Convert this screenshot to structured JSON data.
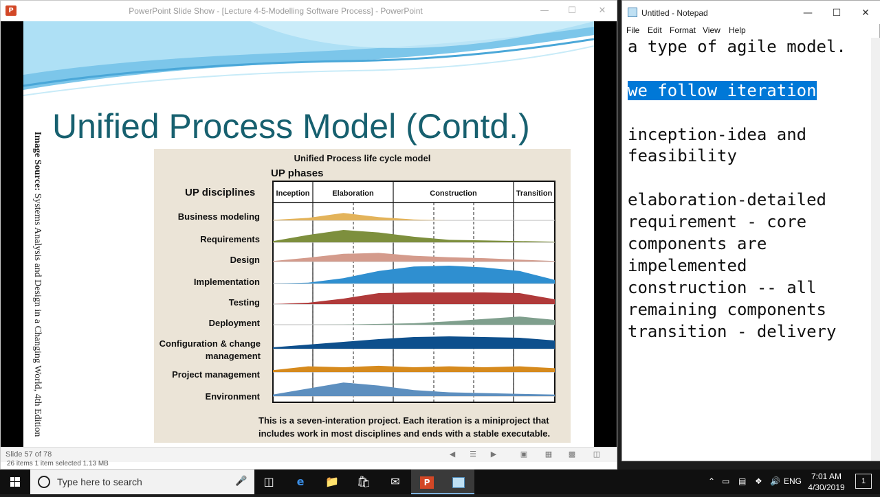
{
  "powerpoint": {
    "title": "PowerPoint Slide Show - [Lecture 4-5-Modelling Software Process] - PowerPoint",
    "logo_letter": "P",
    "status_slide": "Slide 57 of 78",
    "behind_status": "26 items     1 item selected  1.13 MB"
  },
  "slide": {
    "title": "Unified Process Model (Contd.)",
    "image_source_bold": "Image Source:",
    "image_source_text": " Systems Analysis and Design in a Changing World, 4th Edition",
    "figure": {
      "title": "Unified Process life cycle model",
      "phases_label": "UP phases",
      "disciplines_label": "UP disciplines",
      "phases": [
        "Inception",
        "Elaboration",
        "Construction",
        "Transition"
      ],
      "disciplines": [
        "Business modeling",
        "Requirements",
        "Design",
        "Implementation",
        "Testing",
        "Deployment",
        "Configuration & change management",
        "Project management",
        "Environment"
      ],
      "discipline_colors": [
        "#e3b35a",
        "#7d8f3d",
        "#d49b8c",
        "#2f8fd0",
        "#b03a3a",
        "#7f9f8d",
        "#0d4f8c",
        "#d68a1d",
        "#5d8fbf"
      ],
      "caption": "This is a seven-interation project. Each iteration is a miniproject that includes work in most disciplines and ends with a stable executable."
    }
  },
  "notepad": {
    "title": "Untitled - Notepad",
    "menu": [
      "File",
      "Edit",
      "Format",
      "View",
      "Help"
    ],
    "lines": [
      "a type of agile model.",
      "",
      "we follow iteration",
      "",
      "inception-idea and",
      "feasibility",
      "",
      "elaboration-detailed",
      "requirement - core",
      "components are",
      "impelemented",
      "construction -- all",
      "remaining components",
      "transition - delivery"
    ],
    "selected_line": "we follow iteration"
  },
  "taskbar": {
    "search_placeholder": "Type here to search",
    "lang": "ENG",
    "time": "7:01 AM",
    "date": "4/30/2019",
    "notification_count": "1"
  },
  "icons": [
    "powerpoint-icon",
    "notepad-icon",
    "windows-start-icon",
    "search-icon",
    "microphone-icon",
    "task-view-icon",
    "edge-icon",
    "file-explorer-icon",
    "store-icon",
    "mail-icon",
    "chevron-up-icon",
    "battery-icon",
    "network-icon",
    "volume-icon",
    "notifications-icon"
  ]
}
